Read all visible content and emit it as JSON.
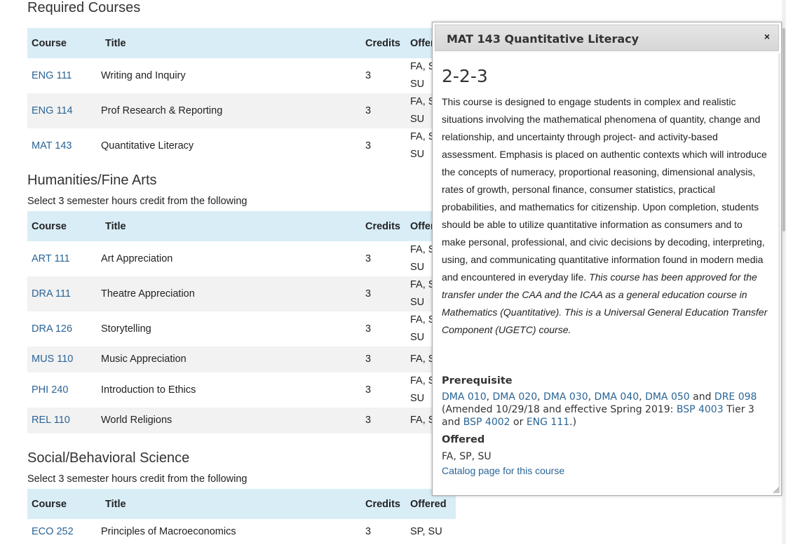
{
  "table_headers": {
    "course": "Course",
    "title": "Title",
    "credits": "Credits",
    "offered": "Offered"
  },
  "sections": [
    {
      "heading": "Required Courses",
      "note": "",
      "rows": [
        {
          "code": "ENG 111",
          "title": "Writing and Inquiry",
          "credits": "3",
          "offered": [
            "FA, SP,",
            "SU"
          ]
        },
        {
          "code": "ENG 114",
          "title": "Prof Research & Reporting",
          "credits": "3",
          "offered": [
            "FA, SP,",
            "SU"
          ]
        },
        {
          "code": "MAT 143",
          "title": "Quantitative Literacy",
          "credits": "3",
          "offered": [
            "FA, SP,",
            "SU"
          ]
        }
      ]
    },
    {
      "heading": "Humanities/Fine Arts",
      "note": "Select 3 semester hours credit from the following",
      "rows": [
        {
          "code": "ART 111",
          "title": "Art Appreciation",
          "credits": "3",
          "offered": [
            "FA, SP,",
            "SU"
          ]
        },
        {
          "code": "DRA 111",
          "title": "Theatre Appreciation",
          "credits": "3",
          "offered": [
            "FA, SP,",
            "SU"
          ]
        },
        {
          "code": "DRA 126",
          "title": "Storytelling",
          "credits": "3",
          "offered": [
            "FA, SP,",
            "SU"
          ]
        },
        {
          "code": "MUS 110",
          "title": "Music Appreciation",
          "credits": "3",
          "offered": [
            "FA, SP"
          ]
        },
        {
          "code": "PHI 240",
          "title": "Introduction to Ethics",
          "credits": "3",
          "offered": [
            "FA, SP,",
            "SU"
          ]
        },
        {
          "code": "REL 110",
          "title": "World Religions",
          "credits": "3",
          "offered": [
            "FA, SP"
          ]
        }
      ]
    },
    {
      "heading": "Social/Behavioral Science",
      "note": "Select 3 semester hours credit from the following",
      "rows": [
        {
          "code": "ECO 252",
          "title": "Principles of Macroeconomics",
          "credits": "3",
          "offered": [
            "SP, SU"
          ]
        }
      ]
    }
  ],
  "dialog": {
    "title": "MAT 143 Quantitative Literacy",
    "close_glyph": "×",
    "hours": "2-2-3",
    "description": "This course is designed to engage students in complex and realistic situations involving the mathematical phenomena of quantity, change and relationship, and uncertainty through project- and activity-based assessment.  Emphasis is placed on authentic contexts which will introduce the concepts of numeracy, proportional reasoning, dimensional analysis, rates of growth, personal finance, consumer statistics, practical probabilities, and mathematics for citizenship.  Upon completion, students should be able to utilize quantitative information as consumers and to make personal, professional, and civic decisions by decoding, interpreting, using, and communicating quantitative information found in modern media and encountered in everyday life.",
    "transfer_note": "This course has been approved for the transfer under the CAA and the ICAA as a general education course in Mathematics (Quantitative).  This is a Universal General Education Transfer Component (UGETC) course.",
    "prereq_label": "Prerequisite",
    "prereq_links": [
      "DMA 010",
      "DMA 020",
      "DMA 030",
      "DMA 040",
      "DMA 050"
    ],
    "prereq_and": "and",
    "prereq_dre": "DRE 098",
    "prereq_amended": "(Amended 10/29/18 and effective Spring 2019:",
    "prereq_bsp4003": "BSP 4003",
    "prereq_tier": "Tier 3 and",
    "prereq_bsp4002": "BSP 4002",
    "prereq_or": "or",
    "prereq_eng": "ENG 111",
    "prereq_close": ".)",
    "offered_label": "Offered",
    "offered_value": "FA, SP, SU",
    "catalog_link": "Catalog page for this course"
  }
}
